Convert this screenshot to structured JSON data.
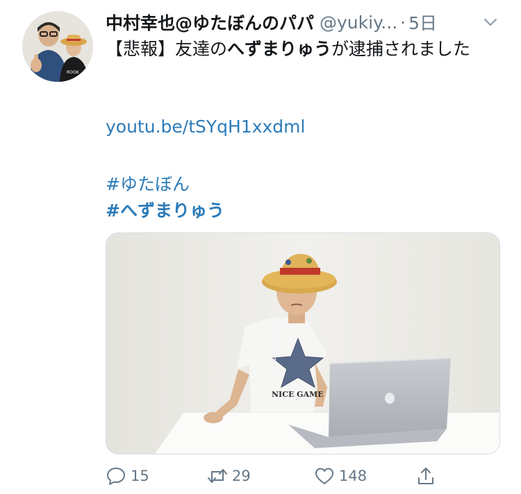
{
  "tweet": {
    "author_name": "中村幸也@ゆたぼんのパパ",
    "author_handle": "@yukiy...",
    "separator": "·",
    "time": "5日",
    "text": {
      "part1": "【悲報】友達の",
      "bold": "へずまりゅう",
      "part2": "が逮捕されました"
    },
    "link": "youtu.be/tSYqH1xxdml",
    "hashtags": [
      "#ゆたぼん",
      "#へずまりゅう"
    ],
    "media": {
      "shirt_text": "NICE GAME"
    }
  },
  "actions": {
    "reply_count": "15",
    "retweet_count": "29",
    "like_count": "148"
  },
  "icons": {
    "avatar": "avatar-photo",
    "menu": "chevron-down-icon",
    "reply": "reply-icon",
    "retweet": "retweet-icon",
    "like": "heart-icon",
    "share": "share-icon"
  },
  "colors": {
    "link": "#2b7bb9",
    "secondary": "#657786",
    "text": "#14171a"
  }
}
